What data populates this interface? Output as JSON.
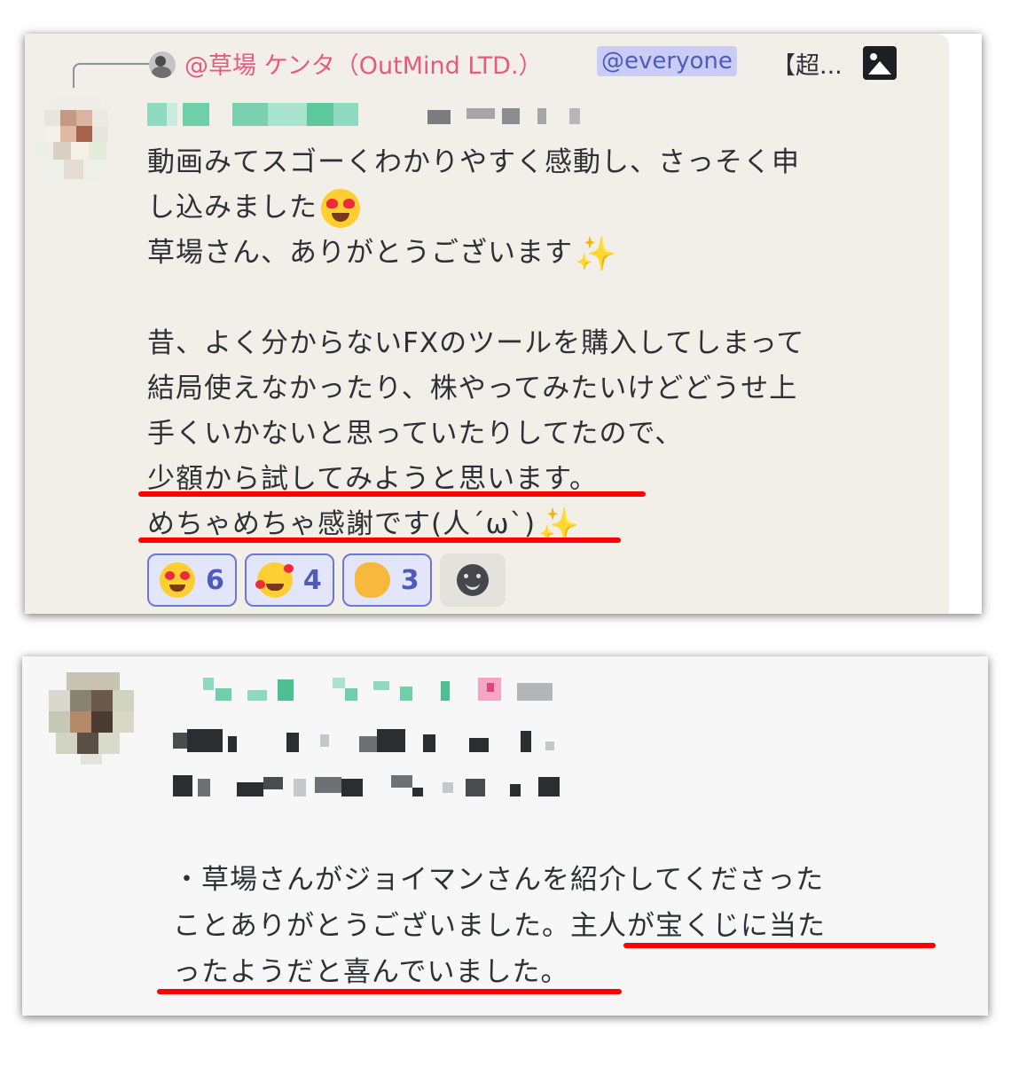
{
  "card1": {
    "reply": {
      "author": "@草場 ケンタ（OutMind LTD.）",
      "mention": "@everyone",
      "preview": "【超..."
    },
    "lines": [
      "動画みてスゴーくわかりやすく感動し、さっそく申",
      "し込みました",
      "草場さん、ありがとうございます",
      "",
      "昔、よく分からないFXのツールを購入してしまって",
      "結局使えなかったり、株やってみたいけどどうせ上",
      "手くいかないと思っていたりしてたので、",
      "少額から試してみようと思います。",
      "めちゃめちゃ感謝です(人´ω`)"
    ],
    "reactions": [
      {
        "emoji": "heart-eyes",
        "count": "6"
      },
      {
        "emoji": "smiling-face-with-hearts",
        "count": "4"
      },
      {
        "emoji": "clapping-hands",
        "count": "3"
      }
    ]
  },
  "card2": {
    "lines": [
      "・草場さんがジョイマンさんを紹介してくださった",
      "ことありがとうございました。主人が宝くじに当た",
      "ったようだと喜んでいました。"
    ]
  },
  "colors": {
    "highlight_underline": "#ff0000",
    "reply_name": "#e75a7c",
    "mention_bg": "#c9cdf5",
    "reaction_border": "#6b77d8"
  }
}
